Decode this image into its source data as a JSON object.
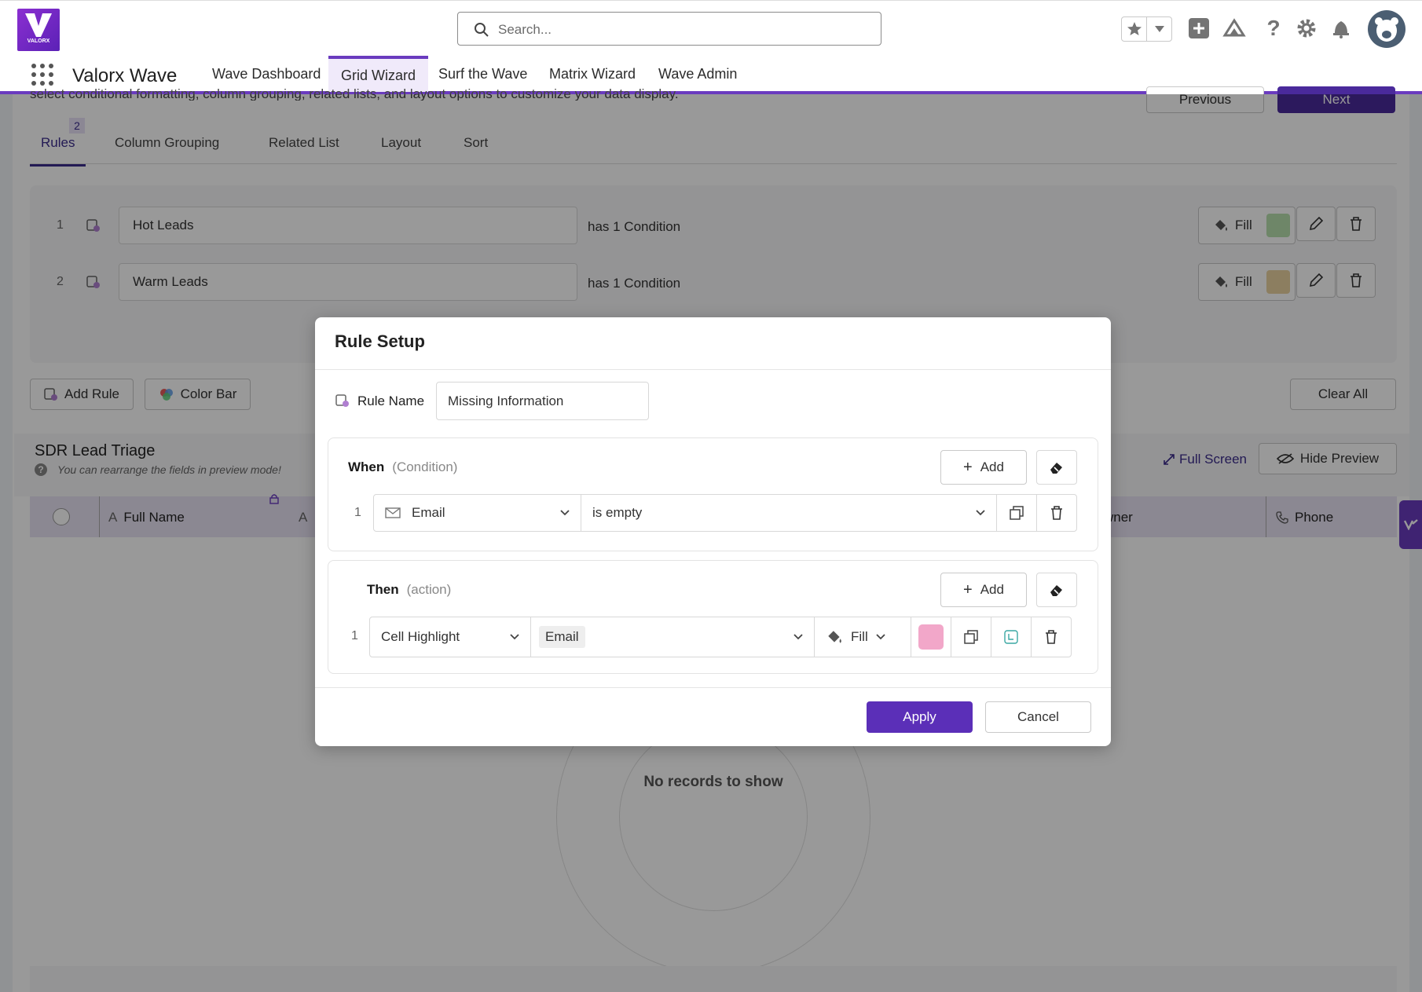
{
  "header": {
    "brand": "VALORX",
    "app_name": "Valorx Wave",
    "search_placeholder": "Search...",
    "nav": [
      "Wave Dashboard",
      "Grid Wizard",
      "Surf the Wave",
      "Matrix Wizard",
      "Wave Admin"
    ],
    "active_nav": "Grid Wizard"
  },
  "page": {
    "intro": "select conditional formatting, column grouping, related lists, and layout options to customize your data display.",
    "previous_label": "Previous",
    "next_label": "Next",
    "tabs": [
      {
        "label": "Rules",
        "badge": "2"
      },
      {
        "label": "Column Grouping"
      },
      {
        "label": "Related List"
      },
      {
        "label": "Layout"
      },
      {
        "label": "Sort"
      }
    ],
    "rules": [
      {
        "num": "1",
        "name": "Hot Leads",
        "cond": "has 1 Condition",
        "fill_label": "Fill",
        "color": "#b7dfae"
      },
      {
        "num": "2",
        "name": "Warm Leads",
        "cond": "has 1 Condition",
        "fill_label": "Fill",
        "color": "#ead3a0"
      }
    ],
    "add_rule": "Add Rule",
    "color_bar": "Color Bar",
    "clear_all": "Clear All",
    "preview_title": "SDR Lead Triage",
    "preview_hint": "You can rearrange the fields in preview mode!",
    "full_screen": "Full Screen",
    "hide_preview": "Hide Preview",
    "columns": [
      "Full Name",
      "A",
      "wner",
      "Phone"
    ],
    "empty": "No records to show"
  },
  "modal": {
    "title": "Rule Setup",
    "rule_name_label": "Rule Name",
    "rule_name_value": "Missing Information",
    "when_label": "When",
    "when_sub": "(Condition)",
    "then_label": "Then",
    "then_sub": "(action)",
    "add_label": "Add",
    "condition": {
      "num": "1",
      "field": "Email",
      "operator": "is empty"
    },
    "action": {
      "num": "1",
      "type": "Cell Highlight",
      "field": "Email",
      "style": "Fill",
      "color": "#f2a7c9"
    },
    "apply": "Apply",
    "cancel": "Cancel"
  }
}
